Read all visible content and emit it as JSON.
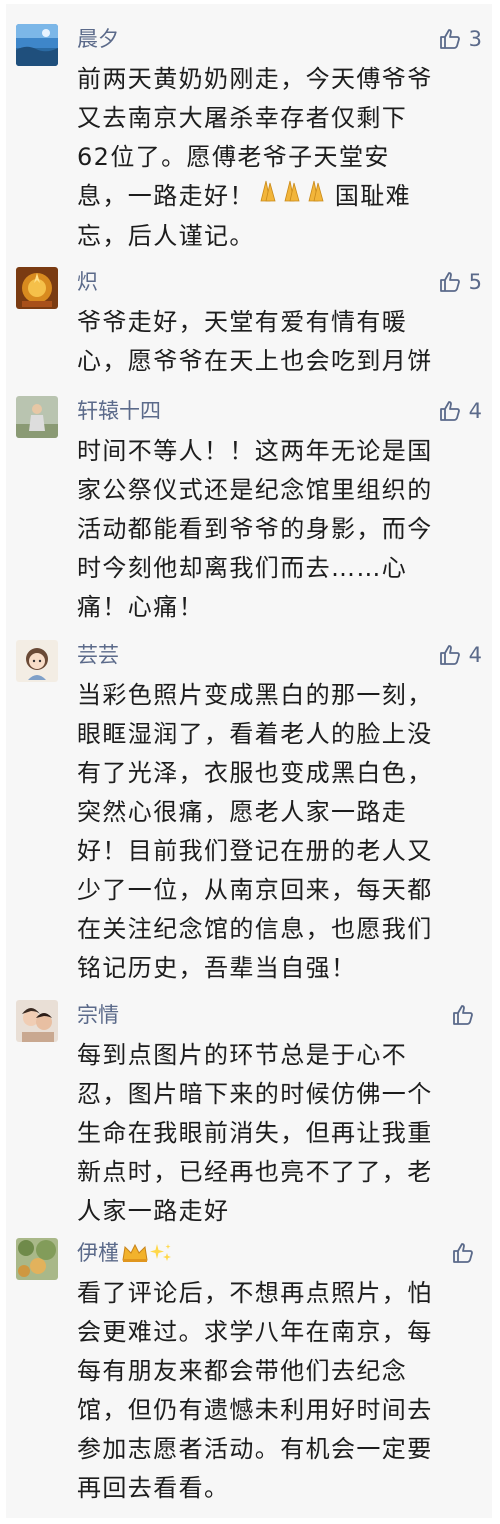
{
  "comments": [
    {
      "name": "晨夕",
      "likes": "3",
      "lines": [
        "前两天黄奶奶刚走，今天傅爷爷",
        "又去南京大屠杀幸存者仅剩下",
        "62位了。愿傅老爷子天堂安",
        "息，一路走好！",
        "忘，后人谨记。"
      ],
      "line4_suffix": "国耻难",
      "avatar": "landscape-avatar"
    },
    {
      "name": "炽",
      "likes": "5",
      "lines": [
        "爷爷走好，天堂有爱有情有暖",
        "心，愿爷爷在天上也会吃到月饼"
      ],
      "avatar": "ornament-avatar"
    },
    {
      "name": "轩辕十四",
      "likes": "4",
      "lines": [
        "时间不等人！！这两年无论是国",
        "家公祭仪式还是纪念馆里组织的",
        "活动都能看到爷爷的身影，而今",
        "时今刻他却离我们而去……心",
        "痛！心痛！"
      ],
      "avatar": "person-avatar"
    },
    {
      "name": "芸芸",
      "likes": "4",
      "lines": [
        "当彩色照片变成黑白的那一刻，",
        "眼眶湿润了，看着老人的脸上没",
        "有了光泽，衣服也变成黑白色，",
        "突然心很痛，愿老人家一路走",
        "好！目前我们登记在册的老人又",
        "少了一位，从南京回来，每天都",
        "在关注纪念馆的信息，也愿我们",
        "铭记历史，吾辈当自强！"
      ],
      "avatar": "cartoon-girl-avatar"
    },
    {
      "name": "宗情",
      "likes": "",
      "lines": [
        "每到点图片的环节总是于心不",
        "忍，图片暗下来的时候仿佛一个",
        "生命在我眼前消失，但再让我重",
        "新点时，已经再也亮不了了，老",
        "人家一路走好"
      ],
      "avatar": "couple-avatar"
    },
    {
      "name": "伊槿",
      "likes": "",
      "lines": [
        "看了评论后，不想再点照片，怕",
        "会更难过。求学八年在南京，每",
        "每有朋友来都会带他们去纪念",
        "馆，但仍有遗憾未利用好时间去",
        "参加志愿者活动。有机会一定要",
        "再回去看看。"
      ],
      "avatar": "garden-avatar"
    }
  ],
  "colors": {
    "name": "#5b6a8a",
    "text": "#1d1d1d",
    "background": "#f7f7f7"
  },
  "icons": {
    "like": "thumbs-up-icon",
    "praying_hands": "praying-hands-icon",
    "crown": "crown-emoji",
    "sparkles": "sparkles-emoji"
  }
}
